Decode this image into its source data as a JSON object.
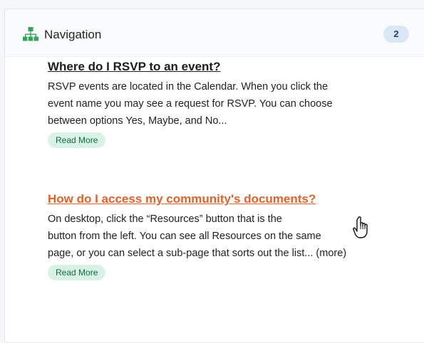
{
  "header": {
    "title": "Navigation",
    "count": "2"
  },
  "icons": {
    "header_icon": "sitemap-icon",
    "cursor": "hand-pointer-icon"
  },
  "colors": {
    "icon_green": "#3aa35a",
    "link_orange": "#e0622b",
    "badge_bg": "#dbe6f6",
    "read_more_bg": "#d8f3e6"
  },
  "articles": [
    {
      "title": "Where do I RSVP to an event?",
      "lines": [
        "RSVP events are located in the Calendar. When you click the",
        "event name you may see a request for RSVP. You can choose",
        "between options Yes, Maybe, and No..."
      ],
      "read_more": "Read More"
    },
    {
      "title": "How do I access my community's documents?",
      "lines": [
        "On desktop, click the “Resources” button that is the",
        "button from the left. You can see all Resources on the same",
        "page, or you can select a sub-page that sorts out the list... (more)"
      ],
      "read_more": "Read More"
    }
  ]
}
